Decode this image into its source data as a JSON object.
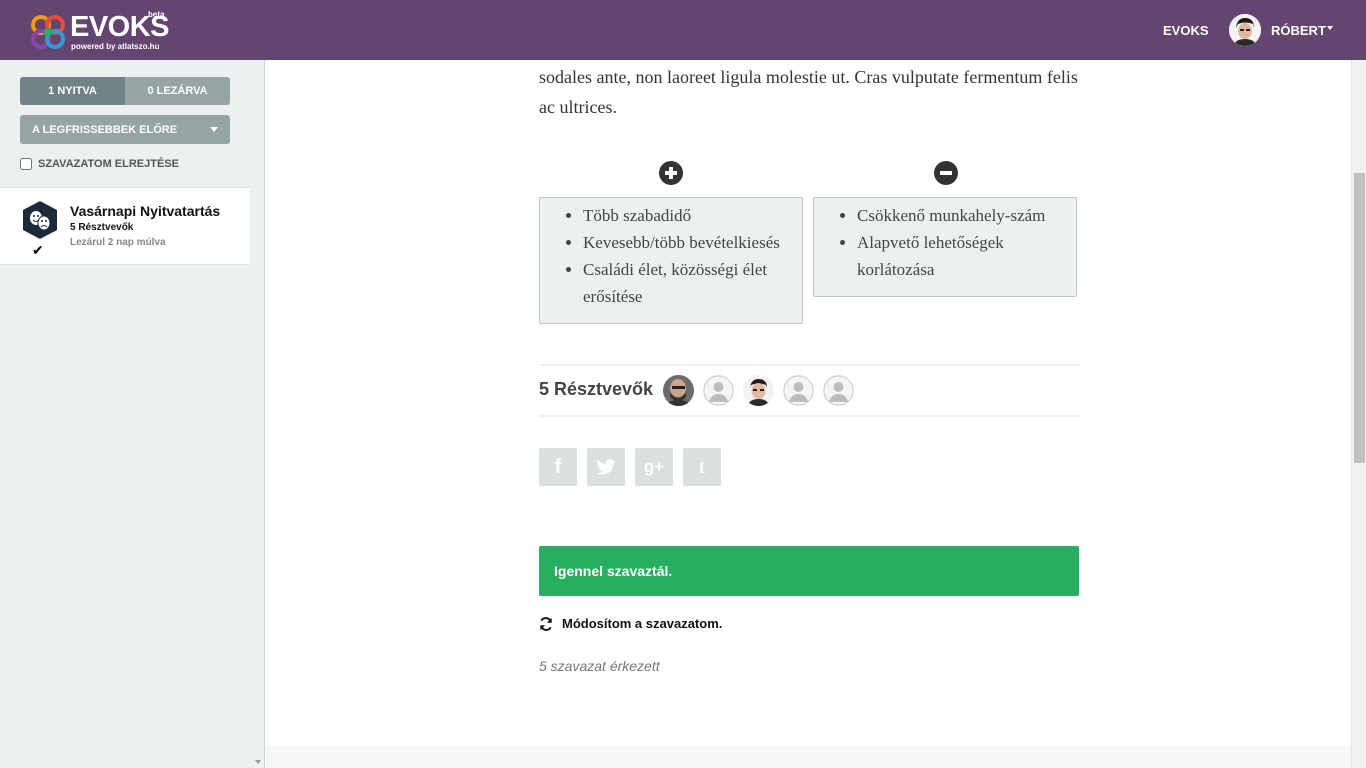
{
  "header": {
    "logo_text": "EVOKS",
    "logo_sub": "powered by atlatszo.hu",
    "logo_beta": "beta",
    "nav_link": "EVOKS",
    "user_name": "RÓBERT"
  },
  "sidebar": {
    "tabs": [
      {
        "label": "1 NYITVA",
        "active": true
      },
      {
        "label": "0 LEZÁRVA",
        "active": false
      }
    ],
    "sort_label": "A LEGFRISSEBBEK ELŐRE",
    "hide_vote_label": "SZAVAZATOM ELREJTÉSE",
    "hide_vote_checked": false,
    "polls": [
      {
        "title": "Vasárnapi Nyitvatartás",
        "participants": "5 Résztvevők",
        "closes": "Lezárul 2 nap múlva",
        "voted": true,
        "icon": "theater-masks-icon"
      }
    ]
  },
  "main": {
    "body_text": "sodales ante, non laoreet ligula molestie ut. Cras vulputate fermentum felis ac ultrices.",
    "pros": [
      "Több szabadidő",
      "Kevesebb/több bevételkiesés",
      "Családi élet, közösségi élet erősítése"
    ],
    "cons": [
      "Csökkenő munkahely-szám",
      "Alapvető lehetőségek korlátozása"
    ],
    "participants_label": "5 Résztvevők",
    "participant_avatars": [
      "avatar-photo-bald",
      "avatar-placeholder",
      "avatar-photo-robert",
      "avatar-placeholder",
      "avatar-placeholder"
    ],
    "share_icons": {
      "fb": "f",
      "gp": "g+",
      "tb": "t"
    },
    "voted_message": "Igennel szavaztál.",
    "change_vote_label": "Módosítom a szavazatom.",
    "vote_count_text": "5 szavazat érkezett"
  },
  "colors": {
    "header_bg": "#63466f",
    "success": "#27ae60",
    "sidebar_bg": "#ecf0f1",
    "button_gray": "#95a5a6"
  }
}
